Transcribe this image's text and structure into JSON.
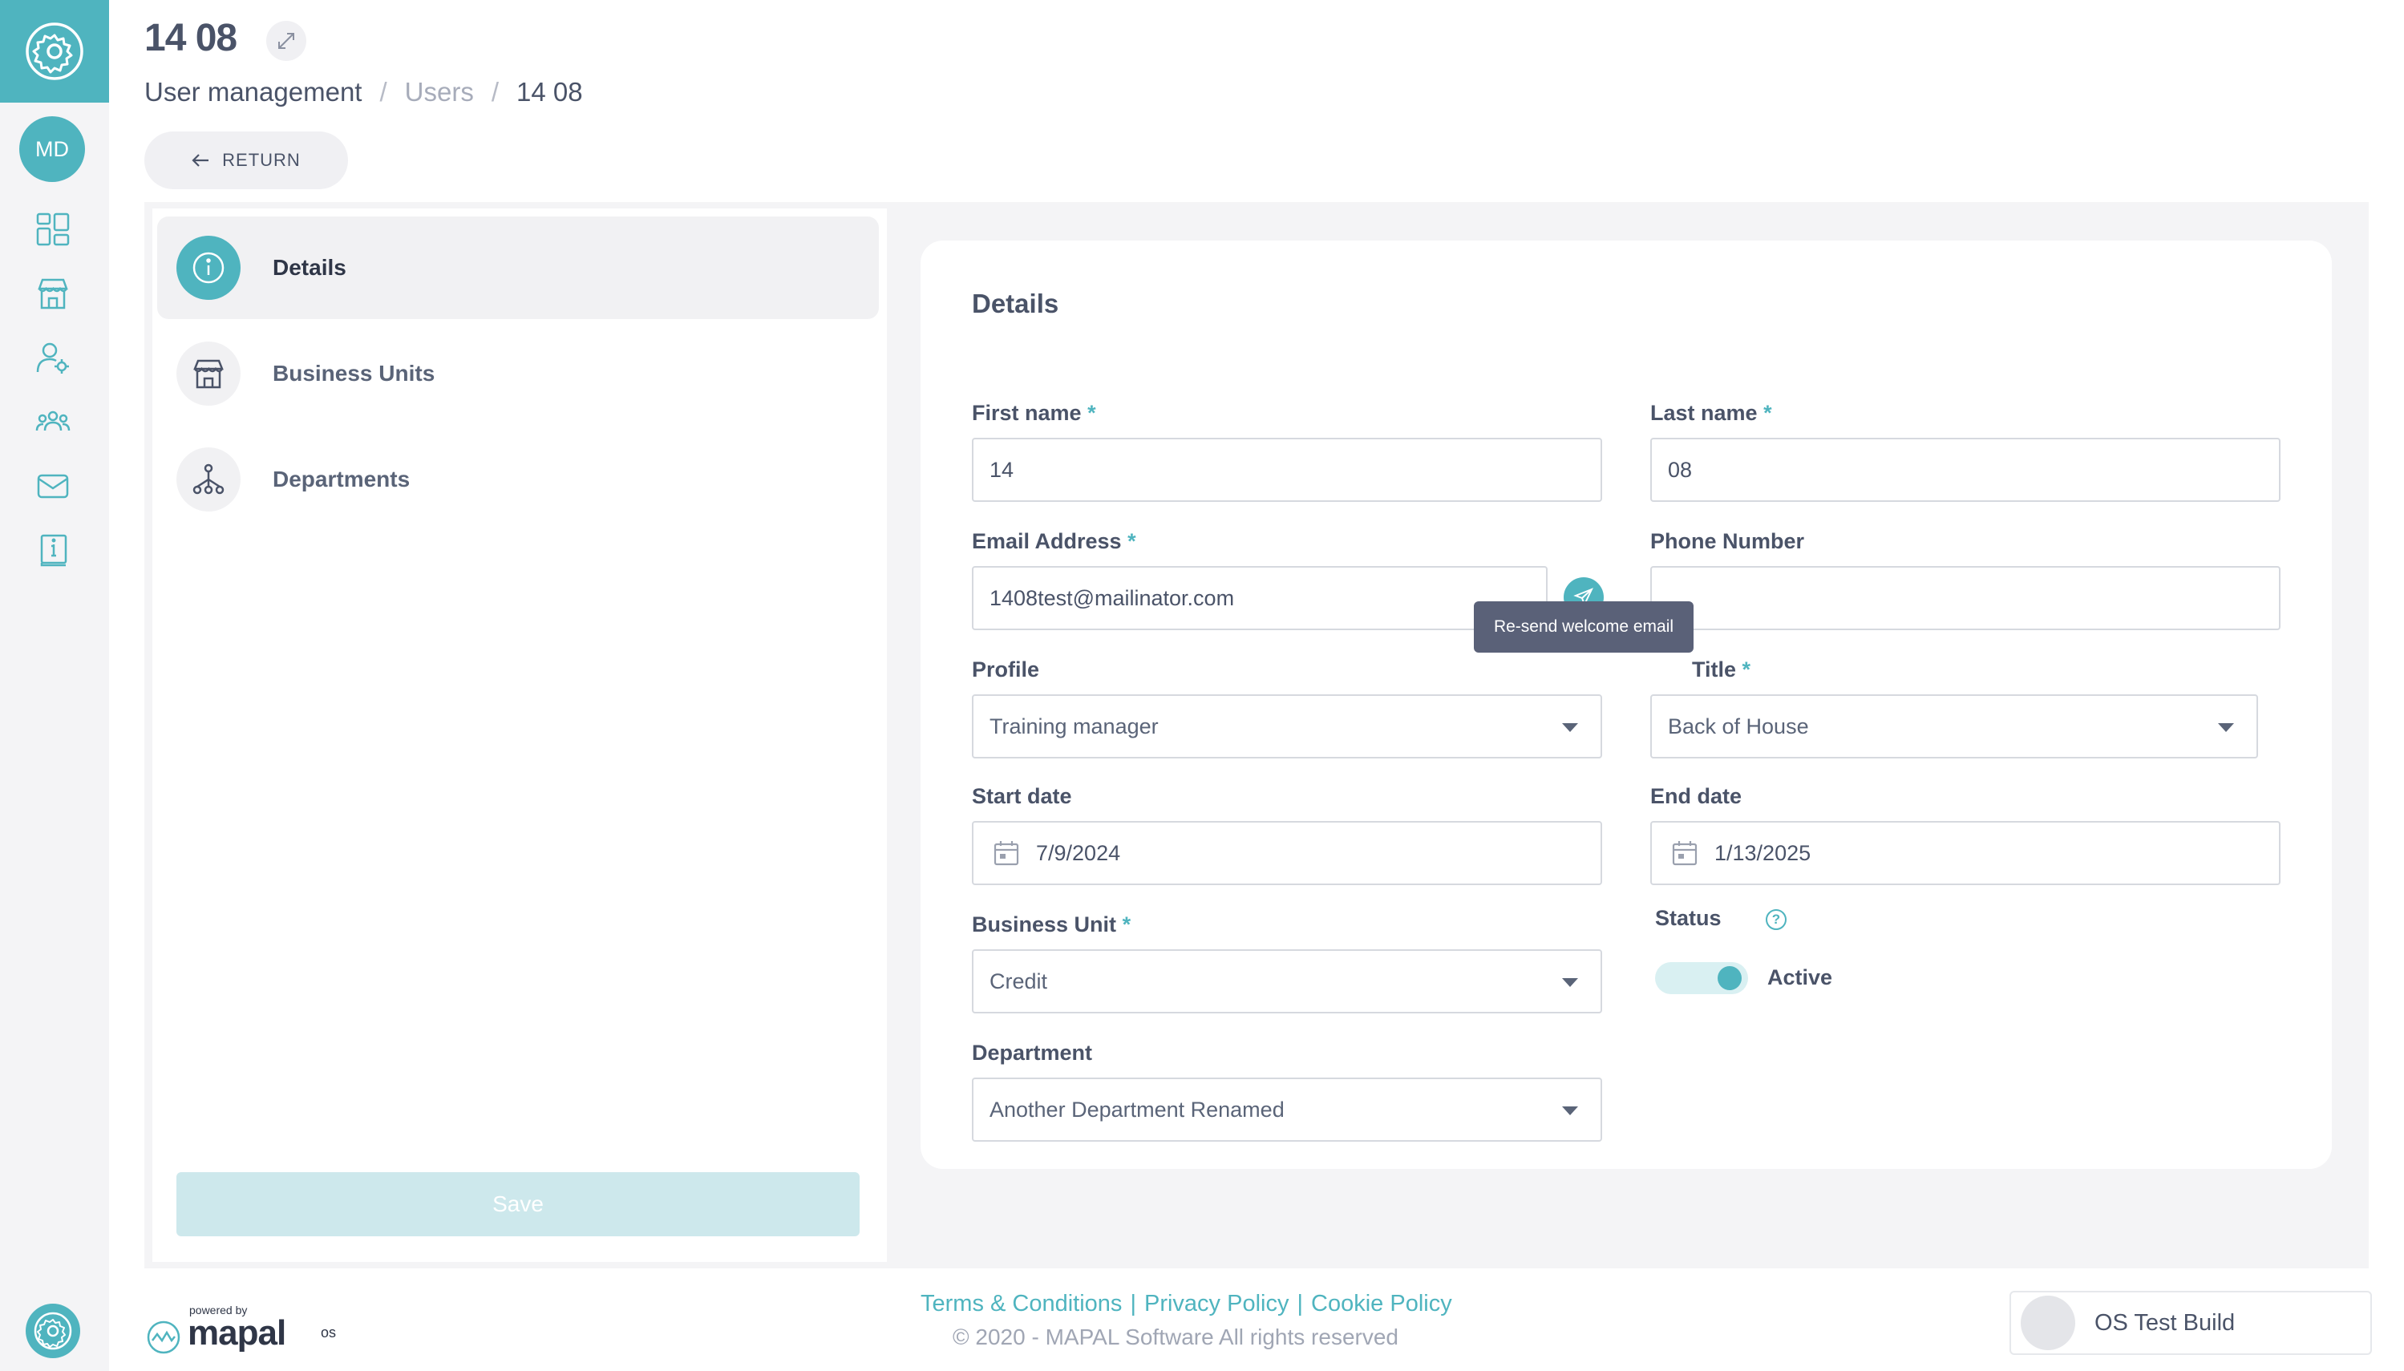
{
  "colors": {
    "accent": "#4fb4bf",
    "text": "#4a5368",
    "muted": "#a7acba",
    "tooltip_bg": "#5a6178",
    "save_disabled": "#cde8ec"
  },
  "rail": {
    "avatar_initials": "MD",
    "icons": [
      "settings-icon",
      "dashboard-icon",
      "store-icon",
      "user-settings-icon",
      "team-icon",
      "mail-icon",
      "info-book-icon",
      "settings-icon"
    ]
  },
  "header": {
    "title": "14 08",
    "breadcrumb": {
      "root": "User management",
      "sep": "/",
      "parent": "Users",
      "current": "14 08"
    },
    "return_label": "RETURN"
  },
  "sidebar": {
    "items": [
      {
        "label": "Details",
        "icon": "info-icon",
        "active": true
      },
      {
        "label": "Business Units",
        "icon": "store-icon",
        "active": false
      },
      {
        "label": "Departments",
        "icon": "hierarchy-icon",
        "active": false
      }
    ],
    "save_label": "Save"
  },
  "form": {
    "title": "Details",
    "required_mark": "*",
    "first_name": {
      "label": "First name",
      "value": "14"
    },
    "last_name": {
      "label": "Last name",
      "value": "08"
    },
    "email": {
      "label": "Email Address",
      "value": "1408test@mailinator.com"
    },
    "phone": {
      "label": "Phone Number",
      "value": ""
    },
    "resend_tooltip": "Re-send welcome email",
    "profile": {
      "label": "Profile",
      "value": "Training manager"
    },
    "job_title": {
      "label": "Title",
      "value": "Back of House"
    },
    "start_date": {
      "label": "Start date",
      "value": "7/9/2024"
    },
    "end_date": {
      "label": "End date",
      "value": "1/13/2025"
    },
    "business_unit": {
      "label": "Business Unit",
      "value": "Credit"
    },
    "status": {
      "label": "Status",
      "help": "?",
      "value": "Active",
      "enabled": true
    },
    "department": {
      "label": "Department",
      "value": "Another Department Renamed"
    }
  },
  "footer": {
    "powered_by": "powered by",
    "brand": "mapal",
    "brand_suffix": "os",
    "terms": "Terms & Conditions",
    "privacy": "Privacy Policy",
    "cookie": "Cookie Policy",
    "divider": "|",
    "copyright": "© 2020 - MAPAL Software All rights reserved",
    "build": "OS Test Build"
  }
}
